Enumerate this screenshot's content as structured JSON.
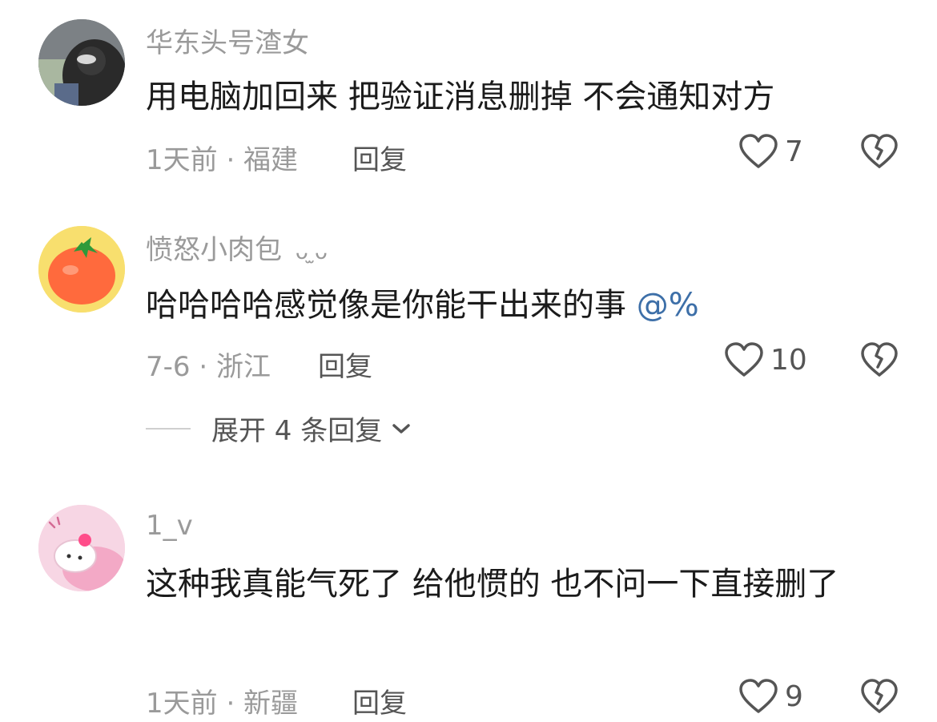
{
  "comments": [
    {
      "username": "华东头号渣女",
      "text": "用电脑加回来 把验证消息删掉 不会通知对方",
      "meta": "1天前 · 福建",
      "reply_label": "回复",
      "likes": "7"
    },
    {
      "username": "愤怒小肉包",
      "username_suffix": "ᴗ ̫ᴗ",
      "text": "哈哈哈哈感觉像是你能干出来的事",
      "mention": "@%",
      "meta": "7-6 · 浙江",
      "reply_label": "回复",
      "likes": "10",
      "expand_label": "展开 4 条回复"
    },
    {
      "username": "1_v",
      "text": "这种我真能气死了 给他惯的 也不问一下直接删了",
      "meta": "1天前 · 新疆",
      "reply_label": "回复",
      "likes": "9"
    }
  ],
  "icons": {
    "like": "heart-outline-icon",
    "dislike": "broken-heart-icon",
    "expand": "chevron-down-icon"
  },
  "colors": {
    "text": "#1b1b1b",
    "secondary": "#9a9a9a",
    "mention": "#3d6fa8"
  }
}
